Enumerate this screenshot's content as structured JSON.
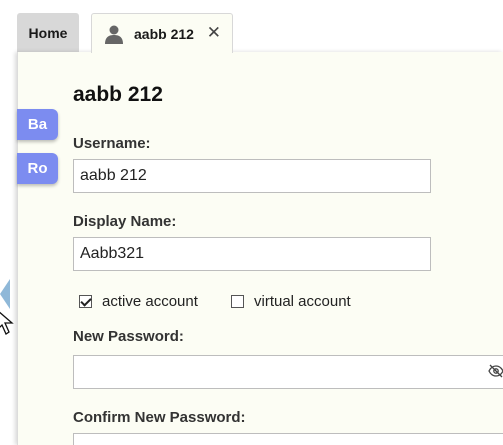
{
  "tabs": {
    "home_label": "Home",
    "active_label": "aabb 212",
    "close_symbol": "✕"
  },
  "side_buttons": {
    "first_label": "Ba",
    "second_label": "Ro"
  },
  "form": {
    "title": "aabb 212",
    "username_label": "Username:",
    "username_value": "aabb 212",
    "display_name_label": "Display Name:",
    "display_name_value": "Aabb321",
    "active_account_label": "active account",
    "active_account_checked": true,
    "virtual_account_label": "virtual account",
    "virtual_account_checked": false,
    "new_password_label": "New Password:",
    "new_password_value": "",
    "confirm_password_label": "Confirm New Password:",
    "confirm_password_value": ""
  },
  "icons": {
    "tab_icon": "user-icon",
    "close_icon": "close-icon",
    "password_toggle": "eye-slash-icon",
    "collapse_arrow": "arrow-left-icon",
    "mouse_cursor": "mouse-cursor-icon"
  },
  "colors": {
    "side_button_bg": "#7c8cf0",
    "panel_bg": "#fcfdf4",
    "home_tab_bg": "#d8d8d8",
    "collapse_arrow": "#8fb8d8"
  }
}
